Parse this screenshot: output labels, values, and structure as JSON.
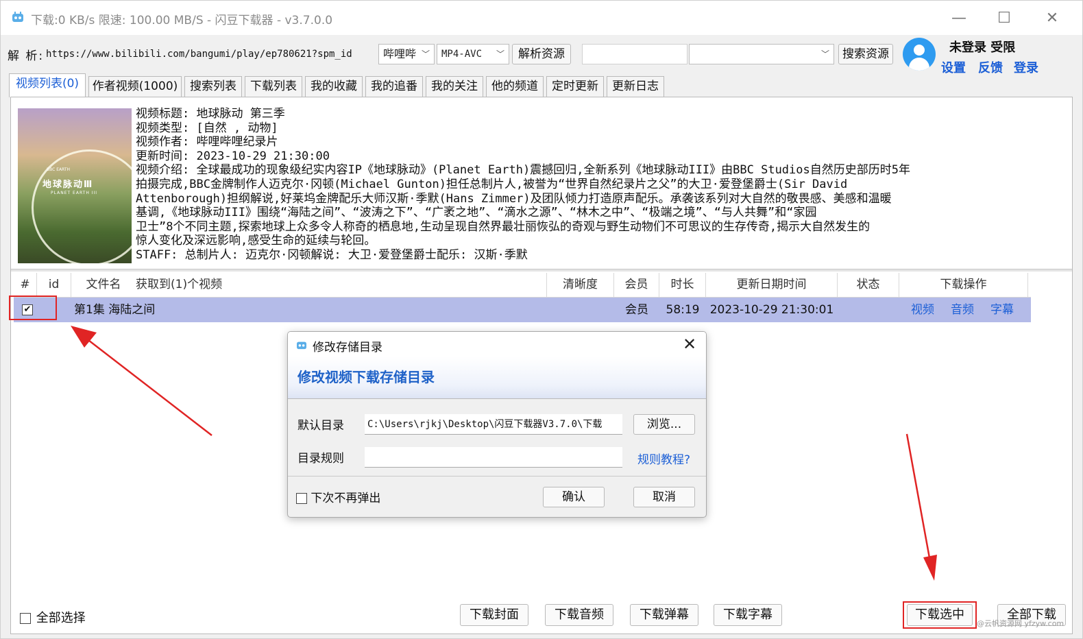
{
  "window": {
    "title": "下载:0 KB/s  限速:  100.00 MB/S  - 闪豆下载器 - v3.7.0.0",
    "minimize": "—",
    "maximize": "☐",
    "close": "✕"
  },
  "parse_bar": {
    "label": "解 析:",
    "url": "https://www.bilibili.com/bangumi/play/ep780621?spm_id",
    "site": "B站",
    "site_display": "哔哩哔",
    "format": "MP4-AVC",
    "parse_button": "解析资源",
    "search_value": "",
    "search_combo_value": "",
    "search_button": "搜索资源"
  },
  "user": {
    "status": "未登录  受限",
    "settings": "设置",
    "feedback": "反馈",
    "login": "登录"
  },
  "tabs": [
    "视频列表(0)",
    "作者视频(1000)",
    "搜索列表",
    "下载列表",
    "我的收藏",
    "我的追番",
    "我的关注",
    "他的频道",
    "定时更新",
    "更新日志"
  ],
  "video_info": {
    "thumb_title": "地球脉动Ⅲ",
    "thumb_subtitle": "PLANET EARTH III",
    "thumb_badge": "BBC EARTH",
    "lines": [
      "视频标题: 地球脉动 第三季",
      "视频类型: [自然 , 动物]",
      "视频作者: 哔哩哔哩纪录片",
      "更新时间: 2023-10-29 21:30:00",
      "视频介绍: 全球最成功的现象级纪实内容IP《地球脉动》(Planet Earth)震撼回归,全新系列《地球脉动III》由BBC Studios自然历史部历时5年",
      "拍摄完成,BBC金牌制作人迈克尔·冈顿(Michael Gunton)担任总制片人,被誉为“世界自然纪录片之父”的大卫·爱登堡爵士(Sir David",
      "Attenborough)担纲解说,好莱坞金牌配乐大师汉斯·季默(Hans Zimmer)及团队倾力打造原声配乐。承袭该系列对大自然的敬畏感、美感和温暖",
      "基调,《地球脉动III》围绕“海陆之间”、“波涛之下”、“广袤之地”、“滴水之源”、“林木之中”、“极端之境”、“与人共舞”和“家园",
      "卫士”8个不同主题,探索地球上众多令人称奇的栖息地,生动呈现自然界最壮丽恢弘的奇观与野生动物们不可思议的生存传奇,揭示大自然发生的",
      "惊人变化及深远影响,感受生命的延续与轮回。",
      "STAFF: 总制片人: 迈克尔·冈顿解说: 大卫·爱登堡爵士配乐: 汉斯·季默"
    ]
  },
  "table": {
    "headers": {
      "hash": "#",
      "id": "id",
      "filename": "文件名",
      "found": "获取到(1)个视频",
      "quality": "清晰度",
      "member": "会员",
      "duration": "时长",
      "updated": "更新日期时间",
      "status": "状态",
      "actions": "下载操作"
    },
    "rows": [
      {
        "checked": "✔",
        "id": "",
        "filename": "第1集 海陆之间",
        "quality": "",
        "member": "会员",
        "duration": "58:19",
        "updated": "2023-10-29 21:30:01",
        "status": "",
        "action_video": "视频",
        "action_audio": "音频",
        "action_subtitle": "字幕"
      }
    ]
  },
  "dialog": {
    "title": "修改存储目录",
    "heading": "修改视频下载存储目录",
    "default_dir_label": "默认目录",
    "default_dir_value": "C:\\Users\\rjkj\\Desktop\\闪豆下载器V3.7.0\\下载",
    "browse": "浏览...",
    "rule_label": "目录规则",
    "rule_value": "",
    "rule_help": "规则教程?",
    "no_popup": "下次不再弹出",
    "confirm": "确认",
    "cancel": "取消",
    "close": "✕"
  },
  "bottom": {
    "select_all": "全部选择",
    "download_cover": "下载封面",
    "download_audio": "下载音频",
    "download_danmaku": "下载弹幕",
    "download_subtitle": "下载字幕",
    "download_selected": "下载选中",
    "download_all": "全部下载",
    "watermark": "@云帆资源网 yfzyw.com"
  },
  "colors": {
    "accent": "#1c5fd6",
    "selected_row": "#b4bbe8",
    "highlight": "#e02424"
  }
}
